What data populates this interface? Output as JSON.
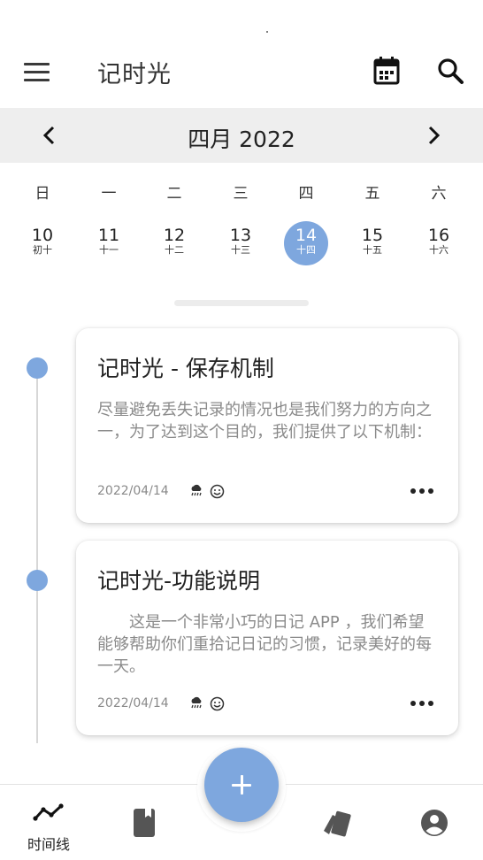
{
  "app": {
    "title": "记时光"
  },
  "calendar": {
    "month_label": "四月 2022",
    "weekdays": [
      "日",
      "一",
      "二",
      "三",
      "四",
      "五",
      "六"
    ],
    "days": [
      {
        "num": "10",
        "lunar": "初十"
      },
      {
        "num": "11",
        "lunar": "十一"
      },
      {
        "num": "12",
        "lunar": "十二"
      },
      {
        "num": "13",
        "lunar": "十三"
      },
      {
        "num": "14",
        "lunar": "十四",
        "selected": true
      },
      {
        "num": "15",
        "lunar": "十五"
      },
      {
        "num": "16",
        "lunar": "十六"
      }
    ],
    "selected_color": "#7ea7de"
  },
  "entries": [
    {
      "title": "记时光 - 保存机制",
      "body": "尽量避免丢失记录的情况也是我们努力的方向之一，为了达到这个目的，我们提供了以下机制：",
      "date": "2022/04/14",
      "weather_icon": "rain-cloud-icon",
      "mood_icon": "smiley-icon"
    },
    {
      "title": "记时光-功能说明",
      "body": "这是一个非常小巧的日记 APP ，我们希望能够帮助你们重拾记日记的习惯，记录美好的每一天。",
      "date": "2022/04/14",
      "weather_icon": "rain-cloud-icon",
      "mood_icon": "smiley-icon"
    }
  ],
  "bottom_nav": {
    "items": [
      {
        "icon": "timeline-icon",
        "label": "时间线"
      },
      {
        "icon": "book-icon",
        "label": ""
      },
      {
        "icon": "cards-icon",
        "label": ""
      },
      {
        "icon": "account-icon",
        "label": ""
      }
    ],
    "fab_icon": "plus-icon"
  },
  "colors": {
    "accent": "#7ea7de",
    "month_bar": "#eeeeee"
  }
}
